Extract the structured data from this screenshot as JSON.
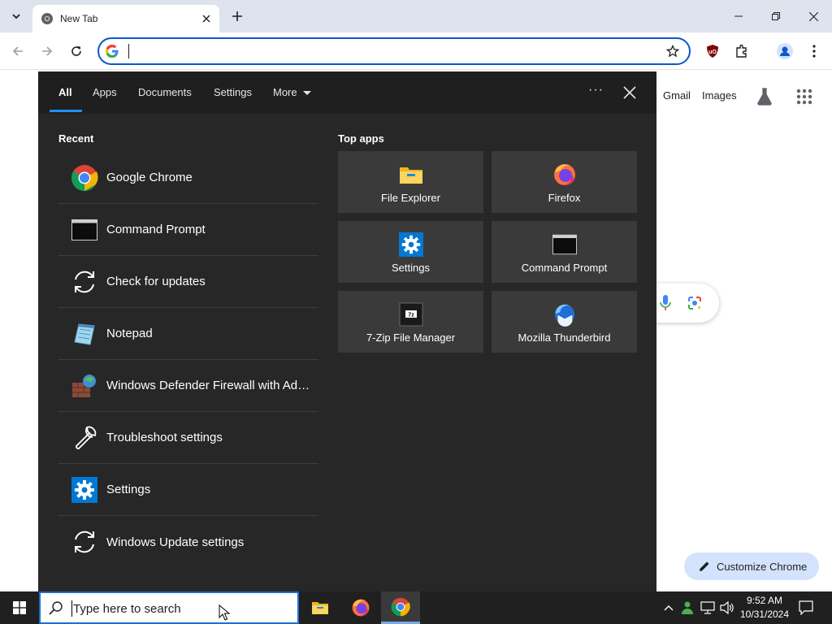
{
  "browser": {
    "tab_title": "New Tab",
    "omnibox_value": "",
    "page_links": {
      "gmail": "Gmail",
      "images": "Images"
    },
    "customize_label": "Customize Chrome"
  },
  "search_flyout": {
    "tabs": [
      "All",
      "Apps",
      "Documents",
      "Settings",
      "More"
    ],
    "active_tab": "All",
    "recent_heading": "Recent",
    "top_apps_heading": "Top apps",
    "recent": [
      {
        "label": "Google Chrome",
        "icon": "chrome-icon"
      },
      {
        "label": "Command Prompt",
        "icon": "command-prompt-icon"
      },
      {
        "label": "Check for updates",
        "icon": "refresh-icon"
      },
      {
        "label": "Notepad",
        "icon": "notepad-icon"
      },
      {
        "label": "Windows Defender Firewall with Advanced Security",
        "icon": "firewall-icon"
      },
      {
        "label": "Troubleshoot settings",
        "icon": "wrench-icon"
      },
      {
        "label": "Settings",
        "icon": "settings-gear-icon"
      },
      {
        "label": "Windows Update settings",
        "icon": "refresh-icon"
      }
    ],
    "top_apps": [
      {
        "label": "File Explorer",
        "icon": "file-explorer-icon"
      },
      {
        "label": "Firefox",
        "icon": "firefox-icon"
      },
      {
        "label": "Settings",
        "icon": "settings-gear-icon"
      },
      {
        "label": "Command Prompt",
        "icon": "command-prompt-icon"
      },
      {
        "label": "7-Zip File Manager",
        "icon": "7zip-icon"
      },
      {
        "label": "Mozilla Thunderbird",
        "icon": "thunderbird-icon"
      }
    ]
  },
  "taskbar": {
    "search_placeholder": "Type here to search",
    "time": "9:52 AM",
    "date": "10/31/2024"
  },
  "colors": {
    "flyout_bg": "#272727",
    "accent": "#1e90ff",
    "omnibox_border": "#0b57d0"
  }
}
